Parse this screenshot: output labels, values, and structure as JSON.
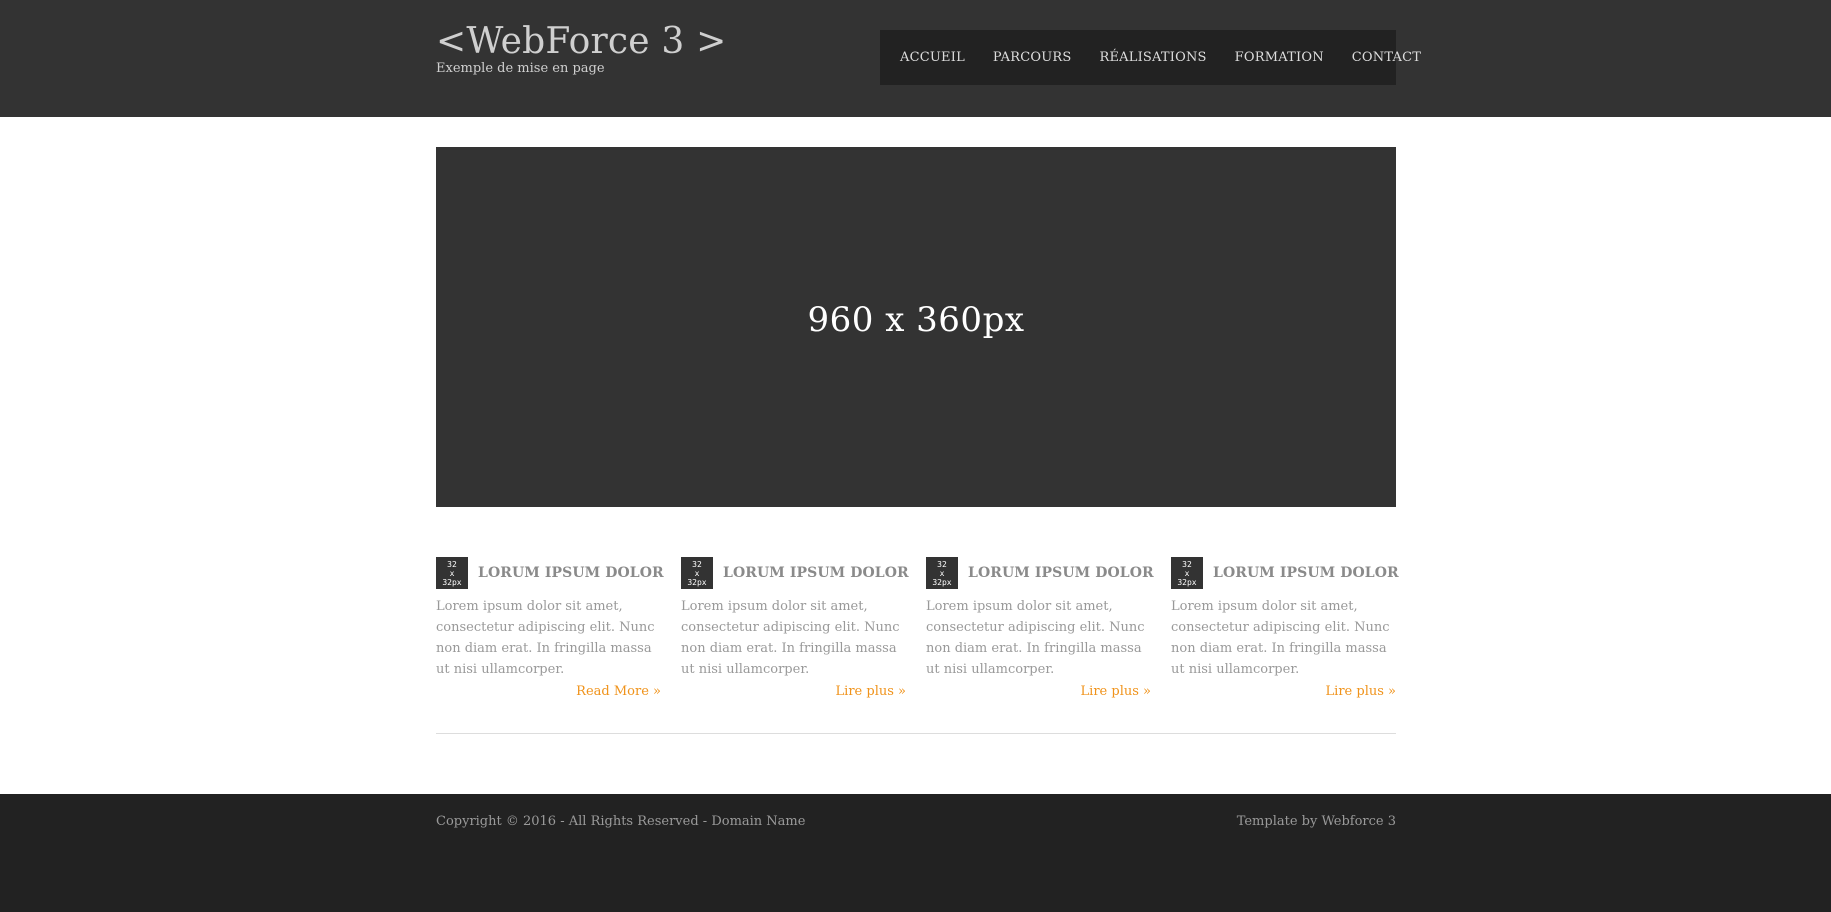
{
  "header": {
    "logo": "<WebForce 3 >",
    "tagline": "Exemple de mise en page"
  },
  "nav": {
    "items": [
      {
        "label": "ACCUEIL"
      },
      {
        "label": "PARCOURS"
      },
      {
        "label": "RÉALISATIONS"
      },
      {
        "label": "FORMATION"
      },
      {
        "label": "CONTACT"
      }
    ]
  },
  "hero": {
    "placeholder": "960 x 360px"
  },
  "features": [
    {
      "thumb": [
        "32",
        "x",
        "32px"
      ],
      "title": "LORUM IPSUM DOLOR",
      "text": "Lorem ipsum dolor sit amet, consectetur adipiscing elit. Nunc non diam erat. In fringilla massa ut nisi ullamcorper.",
      "link": "Read More »"
    },
    {
      "thumb": [
        "32",
        "x",
        "32px"
      ],
      "title": "LORUM IPSUM DOLOR",
      "text": "Lorem ipsum dolor sit amet, consectetur adipiscing elit. Nunc non diam erat. In fringilla massa ut nisi ullamcorper.",
      "link": "Lire plus »"
    },
    {
      "thumb": [
        "32",
        "x",
        "32px"
      ],
      "title": "LORUM IPSUM DOLOR",
      "text": "Lorem ipsum dolor sit amet, consectetur adipiscing elit. Nunc non diam erat. In fringilla massa ut nisi ullamcorper.",
      "link": "Lire plus »"
    },
    {
      "thumb": [
        "32",
        "x",
        "32px"
      ],
      "title": "LORUM IPSUM DOLOR",
      "text": "Lorem ipsum dolor sit amet, consectetur adipiscing elit. Nunc non diam erat. In fringilla massa ut nisi ullamcorper.",
      "link": "Lire plus »"
    }
  ],
  "footer": {
    "copyright": "Copyright © 2016 - All Rights Reserved - Domain Name",
    "credit": "Template by Webforce 3"
  },
  "colors": {
    "header_bg": "#333333",
    "nav_bg": "#222222",
    "footer_bg": "#222222",
    "link_accent": "#f0931b"
  }
}
